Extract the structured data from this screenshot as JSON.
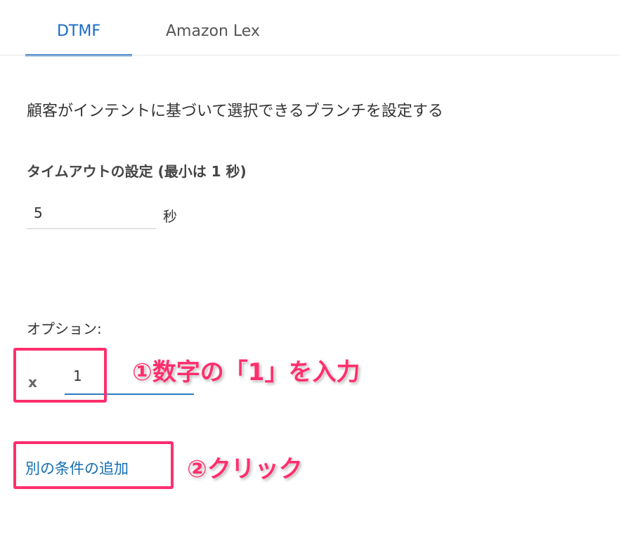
{
  "tabs": [
    {
      "label": "DTMF",
      "active": true
    },
    {
      "label": "Amazon Lex",
      "active": false
    }
  ],
  "description": "顧客がインテントに基づいて選択できるブランチを設定する",
  "timeout": {
    "label": "タイムアウトの設定 (最小は 1 秒)",
    "value": "5",
    "unit": "秒"
  },
  "options": {
    "label": "オプション:",
    "remove": "x",
    "value": "1"
  },
  "add_condition": "別の条件の追加",
  "annotations": {
    "step1": "①数字の「1」を入力",
    "step2": "②クリック"
  },
  "colors": {
    "accent": "#1b6bc6",
    "highlight": "#ff2f6e"
  }
}
